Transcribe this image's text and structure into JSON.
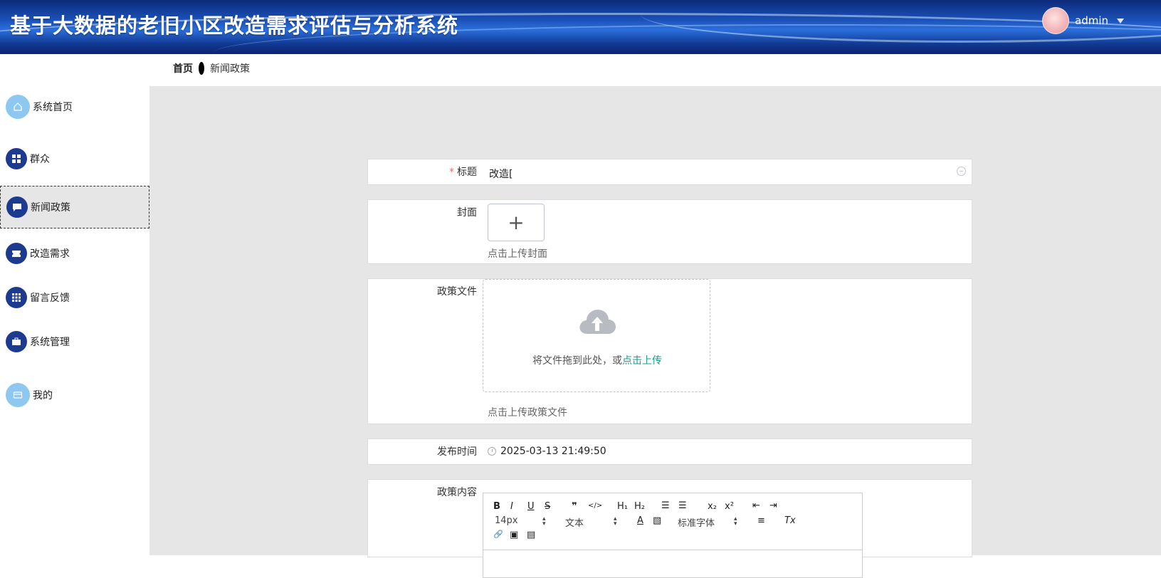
{
  "header": {
    "title": "基于大数据的老旧小区改造需求评估与分析系统",
    "username": "admin"
  },
  "breadcrumb": {
    "home": "首页",
    "current": "新闻政策"
  },
  "sidebar": {
    "items": [
      {
        "label": "系统首页",
        "icon": "home-icon"
      },
      {
        "label": "群众",
        "icon": "grid-icon"
      },
      {
        "label": "新闻政策",
        "icon": "message-icon",
        "active": true
      },
      {
        "label": "改造需求",
        "icon": "ticket-icon"
      },
      {
        "label": "留言反馈",
        "icon": "apps-icon"
      },
      {
        "label": "系统管理",
        "icon": "briefcase-icon"
      },
      {
        "label": "我的",
        "icon": "card-icon"
      }
    ]
  },
  "form": {
    "title_label": "标题",
    "title_value": "改造[",
    "cover_label": "封面",
    "cover_hint": "点击上传封面",
    "file_label": "政策文件",
    "drag_text": "将文件拖到此处，或",
    "drag_link": "点击上传",
    "file_hint": "点击上传政策文件",
    "time_label": "发布时间",
    "time_value": "2025-03-13 21:49:50",
    "content_label": "政策内容"
  },
  "editor": {
    "bold": "B",
    "italic": "I",
    "underline": "U",
    "strike": "S",
    "quote": "❞",
    "code": "</>",
    "h1": "H₁",
    "h2": "H₂",
    "ordered_list": "☰",
    "bullet_list": "☰",
    "subscript": "x₂",
    "superscript": "x²",
    "outdent": "⇤",
    "indent": "⇥",
    "size_value": "14px",
    "header_value": "文本",
    "font_color": "A",
    "background": "▧",
    "font_value": "标准字体",
    "align": "≡",
    "clean": "Tx",
    "link": "🔗",
    "image": "▣",
    "video": "▤"
  }
}
